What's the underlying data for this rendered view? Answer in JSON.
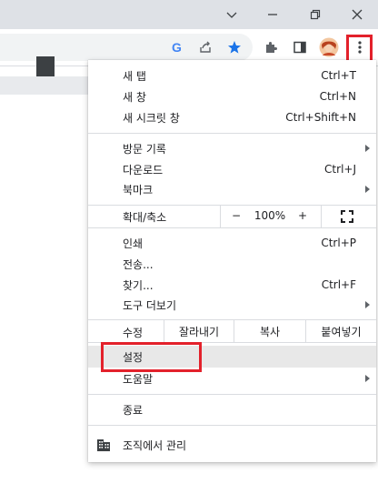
{
  "window": {
    "minimize_icon": "chevron-down-icon",
    "restore_icon": "restore-icon",
    "close_icon": "close-icon"
  },
  "toolbar": {
    "icons": [
      "google-icon",
      "share-icon",
      "bookmark-star-icon",
      "extensions-icon",
      "side-panel-icon",
      "avatar",
      "kebab-menu-icon"
    ]
  },
  "menu": {
    "new_tab": {
      "label": "새 탭",
      "shortcut": "Ctrl+T"
    },
    "new_window": {
      "label": "새 창",
      "shortcut": "Ctrl+N"
    },
    "incognito": {
      "label": "새 시크릿 창",
      "shortcut": "Ctrl+Shift+N"
    },
    "history": {
      "label": "방문 기록"
    },
    "downloads": {
      "label": "다운로드",
      "shortcut": "Ctrl+J"
    },
    "bookmarks": {
      "label": "북마크"
    },
    "zoom": {
      "label": "확대/축소",
      "minus": "−",
      "value": "100%",
      "plus": "+"
    },
    "print": {
      "label": "인쇄",
      "shortcut": "Ctrl+P"
    },
    "cast": {
      "label": "전송..."
    },
    "find": {
      "label": "찾기...",
      "shortcut": "Ctrl+F"
    },
    "more_tools": {
      "label": "도구 더보기"
    },
    "edit": {
      "label": "수정",
      "cut": "잘라내기",
      "copy": "복사",
      "paste": "붙여넣기"
    },
    "settings": {
      "label": "설정"
    },
    "help": {
      "label": "도움말"
    },
    "exit": {
      "label": "종료"
    },
    "managed": {
      "label": "조직에서 관리"
    }
  },
  "colors": {
    "highlight_red": "#e3212b",
    "star_blue": "#1a73e8",
    "hover_gray": "#e8e8e8"
  }
}
